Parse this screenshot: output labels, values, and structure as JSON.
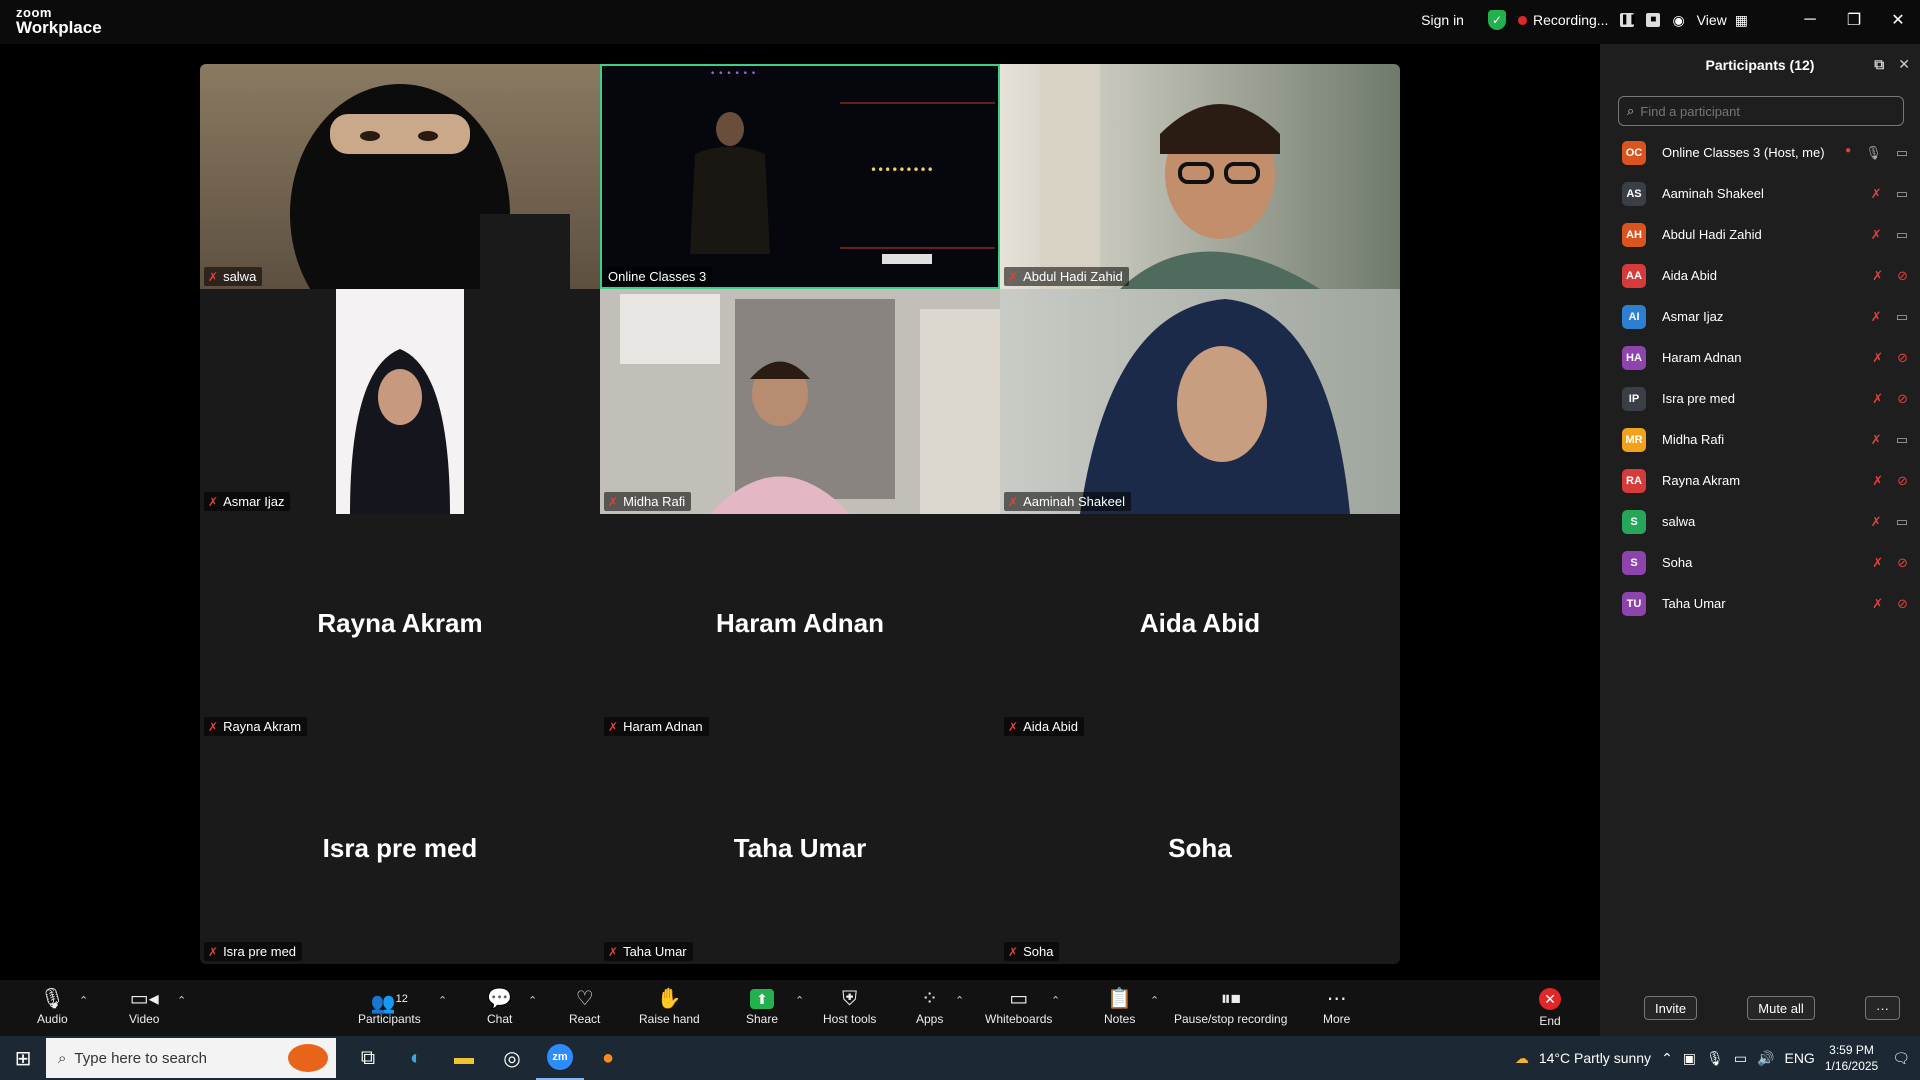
{
  "app": {
    "logo_top": "zoom",
    "logo_bottom": "Workplace"
  },
  "topbar": {
    "sign_in": "Sign in",
    "recording": "Recording...",
    "view": "View"
  },
  "tiles": [
    {
      "name": "salwa",
      "type": "video",
      "bg": "#7a6a55"
    },
    {
      "name": "Online Classes 3",
      "type": "video",
      "bg": "#05070d",
      "active": true
    },
    {
      "name": "Abdul Hadi Zahid",
      "type": "video",
      "bg": "#8a8f7e"
    },
    {
      "name": "Asmar Ijaz",
      "type": "video",
      "bg": "#1a1a1a"
    },
    {
      "name": "Midha Rafi",
      "type": "video",
      "bg": "#b8b4ae"
    },
    {
      "name": "Aaminah Shakeel",
      "type": "video",
      "bg": "#a7ada4"
    },
    {
      "name": "Rayna Akram",
      "type": "avatar",
      "big": "Rayna Akram"
    },
    {
      "name": "Haram Adnan",
      "type": "avatar",
      "big": "Haram Adnan"
    },
    {
      "name": "Aida Abid",
      "type": "avatar",
      "big": "Aida Abid"
    },
    {
      "name": "Isra pre med",
      "type": "avatar",
      "big": "Isra pre med"
    },
    {
      "name": "Taha Umar",
      "type": "avatar",
      "big": "Taha Umar"
    },
    {
      "name": "Soha",
      "type": "avatar",
      "big": "Soha"
    }
  ],
  "panel": {
    "title": "Participants (12)",
    "search_placeholder": "Find a participant",
    "participants": [
      {
        "initials": "OC",
        "name": "Online Classes 3 (Host, me)",
        "color": "#d9541e",
        "mic": "on",
        "cam": "on"
      },
      {
        "initials": "AS",
        "name": "Aaminah Shakeel",
        "color": "#3a3f47",
        "mic": "off",
        "cam": "on"
      },
      {
        "initials": "AH",
        "name": "Abdul Hadi Zahid",
        "color": "#d9541e",
        "mic": "off",
        "cam": "on"
      },
      {
        "initials": "AA",
        "name": "Aida Abid",
        "color": "#d63b3b",
        "mic": "off",
        "cam": "off"
      },
      {
        "initials": "AI",
        "name": "Asmar Ijaz",
        "color": "#2f7fd1",
        "mic": "off",
        "cam": "on"
      },
      {
        "initials": "HA",
        "name": "Haram Adnan",
        "color": "#8e44ad",
        "mic": "off",
        "cam": "off"
      },
      {
        "initials": "IP",
        "name": "Isra pre med",
        "color": "#3a3f47",
        "mic": "off",
        "cam": "off"
      },
      {
        "initials": "MR",
        "name": "Midha Rafi",
        "color": "#f0a21a",
        "mic": "off",
        "cam": "on"
      },
      {
        "initials": "RA",
        "name": "Rayna Akram",
        "color": "#d63b3b",
        "mic": "off",
        "cam": "off"
      },
      {
        "initials": "S",
        "name": "salwa",
        "color": "#26a65b",
        "mic": "off",
        "cam": "on"
      },
      {
        "initials": "S",
        "name": "Soha",
        "color": "#8e44ad",
        "mic": "off",
        "cam": "off"
      },
      {
        "initials": "TU",
        "name": "Taha Umar",
        "color": "#8e44ad",
        "mic": "off",
        "cam": "off"
      }
    ],
    "invite": "Invite",
    "mute_all": "Mute all"
  },
  "toolbar": {
    "audio": "Audio",
    "video": "Video",
    "participants": "Participants",
    "participants_count": "12",
    "chat": "Chat",
    "react": "React",
    "raise_hand": "Raise hand",
    "share": "Share",
    "host_tools": "Host tools",
    "apps": "Apps",
    "whiteboards": "Whiteboards",
    "notes": "Notes",
    "pause_stop": "Pause/stop recording",
    "more": "More",
    "end": "End"
  },
  "taskbar": {
    "search_placeholder": "Type here to search",
    "weather": "14°C  Partly sunny",
    "lang": "ENG",
    "time": "3:59 PM",
    "date": "1/16/2025"
  }
}
